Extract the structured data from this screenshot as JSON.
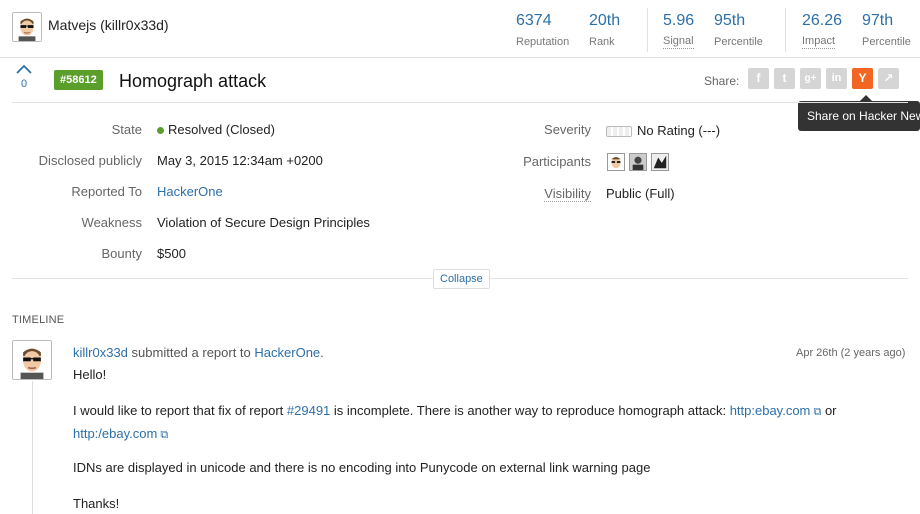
{
  "user": {
    "name": "Matvejs (killr0x33d)"
  },
  "stats": [
    {
      "value": "6374",
      "label": "Reputation"
    },
    {
      "value": "20th",
      "label": "Rank"
    },
    {
      "value": "5.96",
      "label": "Signal"
    },
    {
      "value": "95th",
      "label": "Percentile"
    },
    {
      "value": "26.26",
      "label": "Impact"
    },
    {
      "value": "97th",
      "label": "Percentile"
    }
  ],
  "report": {
    "vote_count": "0",
    "id_badge": "#58612",
    "title": "Homograph attack"
  },
  "share": {
    "label": "Share:",
    "buttons": [
      {
        "icon": "facebook-icon",
        "glyph": "f"
      },
      {
        "icon": "twitter-icon",
        "glyph": "t"
      },
      {
        "icon": "google-plus-icon",
        "glyph": "g+"
      },
      {
        "icon": "linkedin-icon",
        "glyph": "in"
      },
      {
        "icon": "hacker-news-icon",
        "glyph": "Y"
      },
      {
        "icon": "external-share-icon",
        "glyph": "↗"
      }
    ],
    "tooltip": "Share on Hacker News",
    "active_color": "#f26522"
  },
  "meta_left": {
    "state_label": "State",
    "state_value": "Resolved (Closed)",
    "disclosed_label": "Disclosed publicly",
    "disclosed_value": "May 3, 2015 12:34am +0200",
    "reported_label": "Reported To",
    "reported_value": "HackerOne",
    "weakness_label": "Weakness",
    "weakness_value": "Violation of Secure Design Principles",
    "bounty_label": "Bounty",
    "bounty_value": "$500"
  },
  "meta_right": {
    "severity_label": "Severity",
    "severity_value": "No Rating (---)",
    "participants_label": "Participants",
    "visibility_label": "Visibility",
    "visibility_value": "Public (Full)"
  },
  "collapse_label": "Collapse",
  "timeline": {
    "label": "TIMELINE",
    "entry": {
      "author": "killr0x33d",
      "action": "submitted a report to",
      "target": "HackerOne",
      "period": ".",
      "date": "Apr 26th (2 years ago)",
      "greeting": "Hello!",
      "p1_a": "I would like to report that fix of report",
      "p1_ref": "#29491",
      "p1_b": "is incomplete. There is another way to reproduce homograph attack:",
      "p1_link1": "http:ebay.com",
      "p1_or": "or",
      "p1_link2": "http:/ebay.com",
      "p2": "IDNs are displayed in unicode and there is no encoding into Punycode on external link warning page",
      "p3": "Thanks!"
    }
  },
  "colors": {
    "accent": "#2d6fa8",
    "resolved": "#5a9e2c"
  }
}
